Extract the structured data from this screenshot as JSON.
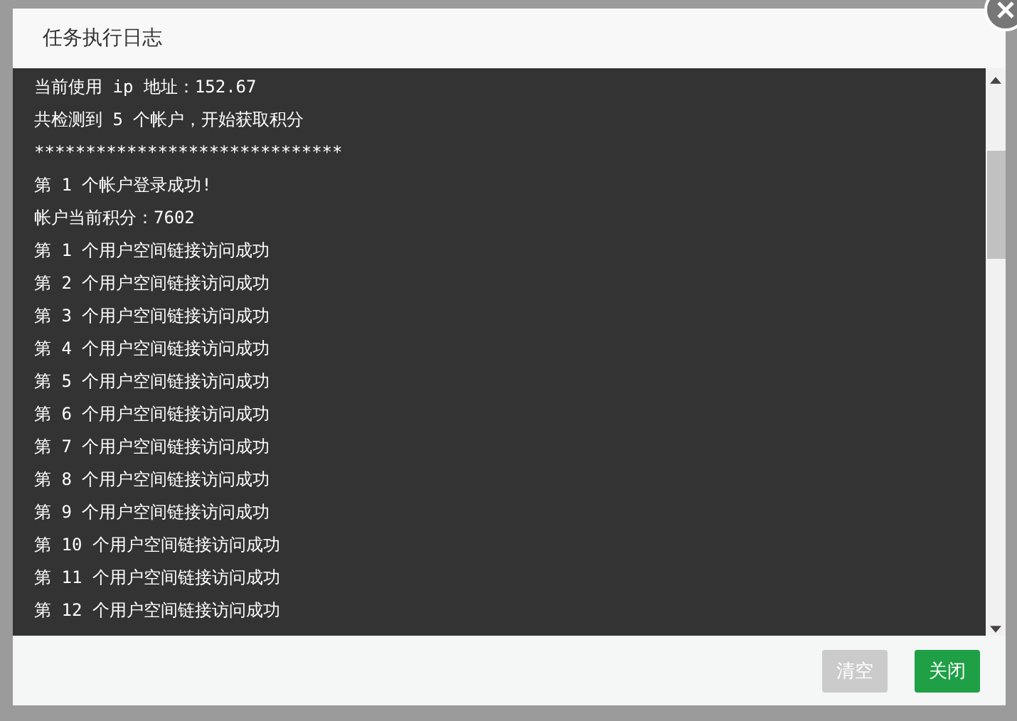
{
  "dialog": {
    "title": "任务执行日志",
    "log_lines": [
      "当前使用 ip 地址：152.67",
      "共检测到 5 个帐户，开始获取积分",
      "******************************",
      "第 1 个帐户登录成功!",
      "帐户当前积分：7602",
      "第 1 个用户空间链接访问成功",
      "第 2 个用户空间链接访问成功",
      "第 3 个用户空间链接访问成功",
      "第 4 个用户空间链接访问成功",
      "第 5 个用户空间链接访问成功",
      "第 6 个用户空间链接访问成功",
      "第 7 个用户空间链接访问成功",
      "第 8 个用户空间链接访问成功",
      "第 9 个用户空间链接访问成功",
      "第 10 个用户空间链接访问成功",
      "第 11 个用户空间链接访问成功",
      "第 12 个用户空间链接访问成功"
    ],
    "buttons": [
      {
        "label": "清空",
        "disabled": true
      },
      {
        "label": "关闭",
        "disabled": false
      }
    ]
  }
}
